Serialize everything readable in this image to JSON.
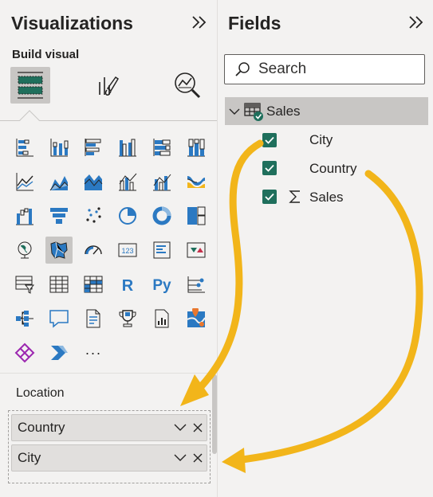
{
  "visualizations": {
    "title": "Visualizations",
    "build_visual_label": "Build visual",
    "location_label": "Location",
    "well_fields": [
      {
        "label": "Country"
      },
      {
        "label": "City"
      }
    ],
    "more_label": "···"
  },
  "fields": {
    "title": "Fields",
    "search_placeholder": "Search",
    "table": {
      "name": "Sales",
      "items": [
        {
          "label": "City",
          "checked": true
        },
        {
          "label": "Country",
          "checked": true
        },
        {
          "label": "Sales",
          "checked": true,
          "measure": true
        }
      ]
    }
  },
  "colors": {
    "accent_green": "#1f6f5c",
    "arrow_yellow": "#f2b51a",
    "icon_blue": "#2b79c2"
  }
}
